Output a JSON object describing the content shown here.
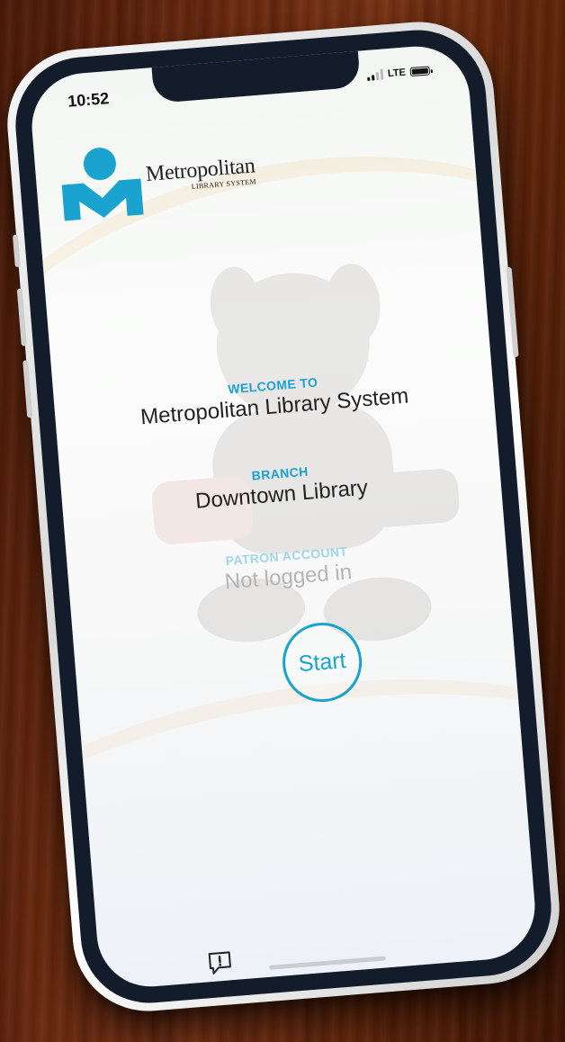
{
  "status_bar": {
    "time": "10:52",
    "network": "LTE"
  },
  "brand": {
    "name": "Metropolitan",
    "subtitle": "LIBRARY SYSTEM"
  },
  "welcome": {
    "label": "WELCOME TO",
    "value": "Metropolitan Library System"
  },
  "branch": {
    "label": "BRANCH",
    "value": "Downtown Library"
  },
  "patron": {
    "label": "PATRON ACCOUNT",
    "value": "Not logged in"
  },
  "start_button": {
    "label": "Start"
  },
  "icons": {
    "feedback": "feedback-alert-icon",
    "account": "user-account-icon"
  },
  "colors": {
    "accent": "#1aa3cf",
    "logo_cyan": "#1aa3cf",
    "bezel": "#131c2b"
  }
}
